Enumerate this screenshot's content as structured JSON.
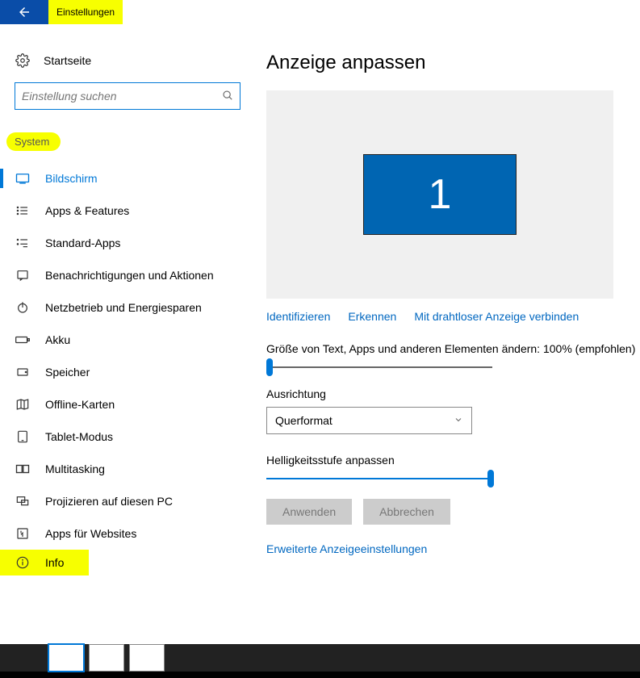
{
  "titlebar": {
    "title": "Einstellungen"
  },
  "sidebar": {
    "home": "Startseite",
    "search_placeholder": "Einstellung suchen",
    "category": "System",
    "items": [
      {
        "label": "Bildschirm",
        "active": true
      },
      {
        "label": "Apps & Features"
      },
      {
        "label": "Standard-Apps"
      },
      {
        "label": "Benachrichtigungen und Aktionen"
      },
      {
        "label": "Netzbetrieb und Energiesparen"
      },
      {
        "label": "Akku"
      },
      {
        "label": "Speicher"
      },
      {
        "label": "Offline-Karten"
      },
      {
        "label": "Tablet-Modus"
      },
      {
        "label": "Multitasking"
      },
      {
        "label": "Projizieren auf diesen PC"
      },
      {
        "label": "Apps für Websites"
      },
      {
        "label": "Info"
      }
    ]
  },
  "content": {
    "heading": "Anzeige anpassen",
    "monitor_number": "1",
    "links": {
      "identify": "Identifizieren",
      "detect": "Erkennen",
      "wireless": "Mit drahtloser Anzeige verbinden"
    },
    "scale_label": "Größe von Text, Apps und anderen Elementen ändern: 100% (empfohlen)",
    "orientation_label": "Ausrichtung",
    "orientation_value": "Querformat",
    "brightness_label": "Helligkeitsstufe anpassen",
    "apply": "Anwenden",
    "cancel": "Abbrechen",
    "advanced": "Erweiterte Anzeigeeinstellungen"
  }
}
